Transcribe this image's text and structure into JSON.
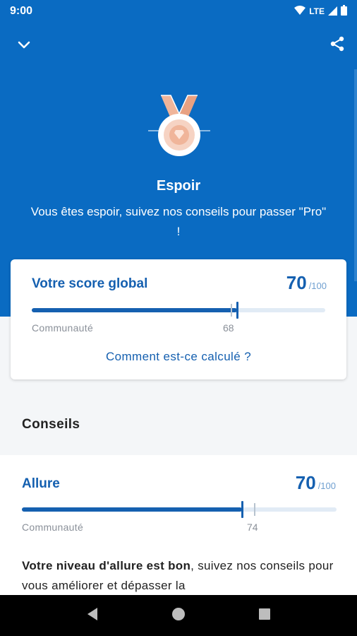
{
  "status": {
    "time": "9:00",
    "network": "LTE"
  },
  "header": {
    "title": "Espoir",
    "subtitle": "Vous êtes espoir, suivez nos conseils pour passer \"Pro\" !",
    "medal_icon": "medal-icon",
    "colors": {
      "brand": "#0a6bc2",
      "medal": "#f0b59a"
    }
  },
  "score_card": {
    "label": "Votre score global",
    "value": "70",
    "max": "/100",
    "progress": 70,
    "community_label": "Communauté",
    "community_value": "68",
    "community_progress": 68,
    "link": "Comment est-ce calculé ?"
  },
  "section": {
    "title": "Conseils"
  },
  "tip": {
    "label": "Allure",
    "value": "70",
    "max": "/100",
    "progress": 70,
    "community_label": "Communauté",
    "community_value": "74",
    "community_progress": 74,
    "text_bold": "Votre niveau d'allure est bon",
    "text_rest": ", suivez nos conseils pour vous améliorer et dépasser la"
  }
}
